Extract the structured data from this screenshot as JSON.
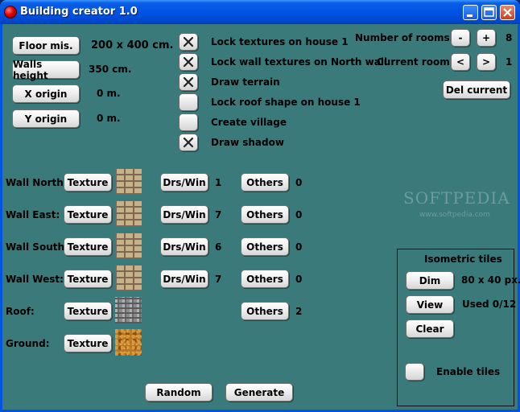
{
  "window": {
    "title": "Building creator 1.0"
  },
  "dimensions": {
    "floor_button": "Floor mis.",
    "floor_value": "200 x 400 cm.",
    "walls_height_button": "Walls height",
    "walls_height_value": "350 cm.",
    "x_origin_button": "X origin",
    "x_origin_value": "0 m.",
    "y_origin_button": "Y origin",
    "y_origin_value": "0 m."
  },
  "options": [
    {
      "label": "Lock textures on house 1",
      "checked": true
    },
    {
      "label": "Lock wall textures on North wall",
      "checked": true
    },
    {
      "label": "Draw terrain",
      "checked": true
    },
    {
      "label": "Lock roof shape on house 1",
      "checked": false
    },
    {
      "label": "Create village",
      "checked": false
    },
    {
      "label": "Draw shadow",
      "checked": true
    }
  ],
  "rooms": {
    "number_label": "Number of rooms:",
    "minus": "-",
    "plus": "+",
    "number_value": "8",
    "current_label": "Current room:",
    "prev": "<",
    "next": ">",
    "current_value": "1",
    "del_button": "Del current"
  },
  "walls": [
    {
      "label": "Wall North:",
      "texture_button": "Texture",
      "drswin_button": "Drs/Win",
      "drswin_count": "1",
      "others_button": "Others",
      "others_count": "0"
    },
    {
      "label": "Wall East:",
      "texture_button": "Texture",
      "drswin_button": "Drs/Win",
      "drswin_count": "7",
      "others_button": "Others",
      "others_count": "0"
    },
    {
      "label": "Wall South:",
      "texture_button": "Texture",
      "drswin_button": "Drs/Win",
      "drswin_count": "6",
      "others_button": "Others",
      "others_count": "0"
    },
    {
      "label": "Wall West:",
      "texture_button": "Texture",
      "drswin_button": "Drs/Win",
      "drswin_count": "7",
      "others_button": "Others",
      "others_count": "0"
    }
  ],
  "roof": {
    "label": "Roof:",
    "texture_button": "Texture",
    "others_button": "Others",
    "others_count": "2"
  },
  "ground": {
    "label": "Ground:",
    "texture_button": "Texture"
  },
  "actions": {
    "random": "Random",
    "generate": "Generate"
  },
  "isometric": {
    "title": "Isometric tiles",
    "dim_button": "Dim",
    "dim_value": "80 x 40 px.",
    "view_button": "View",
    "used_value": "Used 0/12",
    "clear_button": "Clear",
    "enable_label": "Enable tiles",
    "enable_checked": false
  },
  "watermark": {
    "brand": "SOFTPEDIA",
    "url": "www.softpedia.com"
  },
  "icons": {
    "app": "red-ball-icon",
    "checked": "x-check-icon"
  },
  "colors": {
    "client_bg": "#3a7a7a",
    "titlebar": "#0054e3"
  }
}
